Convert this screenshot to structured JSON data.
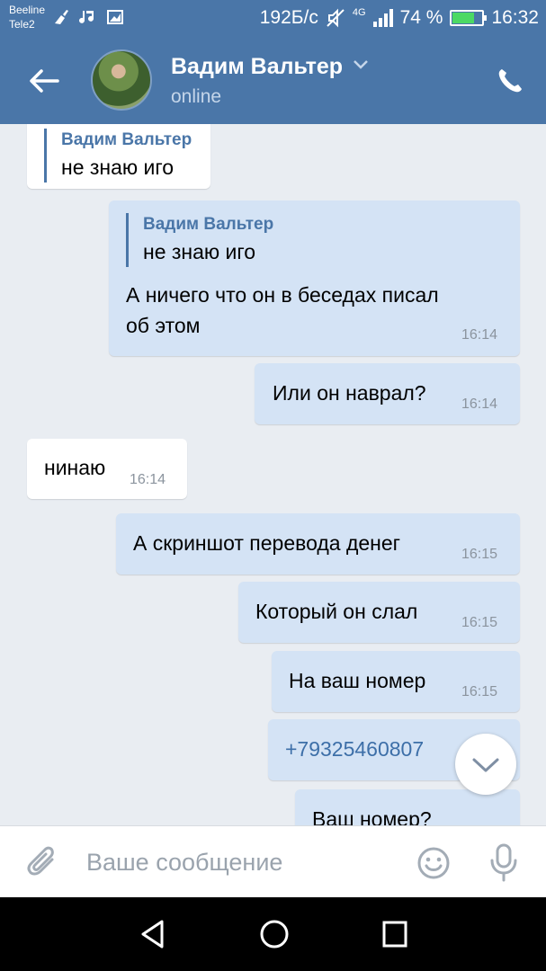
{
  "status_bar": {
    "carrier1": "Beeline",
    "carrier2": "Tele2",
    "speed": "192Б/с",
    "network": "4G",
    "battery": "74 %",
    "battery_level": 0.74,
    "time": "16:32"
  },
  "header": {
    "contact_name": "Вадим Вальтер",
    "status": "online"
  },
  "messages": [
    {
      "side": "in",
      "reply_name": "Вадим Вальтер",
      "reply_text": "не знаю иго"
    },
    {
      "side": "out",
      "reply_name": "Вадим Вальтер",
      "reply_text": "не знаю иго",
      "text_line1": "А ничего что он в беседах писал",
      "text_line2": "об этом",
      "time": "16:14"
    },
    {
      "side": "out",
      "text": "Или он наврал?",
      "time": "16:14"
    },
    {
      "side": "in",
      "text": "нинаю",
      "time": "16:14"
    },
    {
      "side": "out",
      "text": "А скриншот перевода денег",
      "time": "16:15"
    },
    {
      "side": "out",
      "text": "Который он слал",
      "time": "16:15"
    },
    {
      "side": "out",
      "text": "На ваш номер",
      "time": "16:15"
    },
    {
      "side": "out",
      "text": "+79325460807"
    },
    {
      "side": "out",
      "text": "Ваш номер?"
    }
  ],
  "composer": {
    "placeholder": "Ваше сообщение"
  },
  "colors": {
    "brand": "#4a76a8",
    "outgoing_bubble": "#d4e3f5",
    "incoming_bubble": "#ffffff",
    "background": "#e9edf2"
  },
  "icons": [
    "arrow-left-icon",
    "chevron-down-icon",
    "phone-icon",
    "chevron-down-icon",
    "paperclip-icon",
    "smile-icon",
    "microphone-icon",
    "nav-back-icon",
    "nav-home-icon",
    "nav-recents-icon"
  ]
}
